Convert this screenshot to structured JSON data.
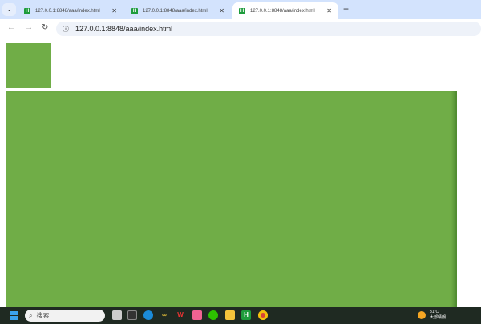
{
  "browser": {
    "tabs": [
      {
        "title": "127.0.0.1:8848/aaa/index.html",
        "active": false
      },
      {
        "title": "127.0.0.1:8848/aaa/index.html",
        "active": false
      },
      {
        "title": "127.0.0.1:8848/aaa/index.html",
        "active": true
      }
    ],
    "tab_search_icon": "chevron-down-icon",
    "new_tab_label": "+",
    "close_label": "✕",
    "back_label": "←",
    "forward_label": "→",
    "reload_label": "↻",
    "address": "127.0.0.1:8848/aaa/index.html"
  },
  "page": {
    "box_color": "#70ad47"
  },
  "taskbar": {
    "search_placeholder": "搜索",
    "apps": [
      "task-view",
      "terminal",
      "edge",
      "app",
      "wps",
      "app-pink",
      "wechat",
      "file-explorer",
      "hbuilder",
      "chrome"
    ],
    "weather": {
      "temp": "31°C",
      "condition": "大部晴朗"
    }
  }
}
